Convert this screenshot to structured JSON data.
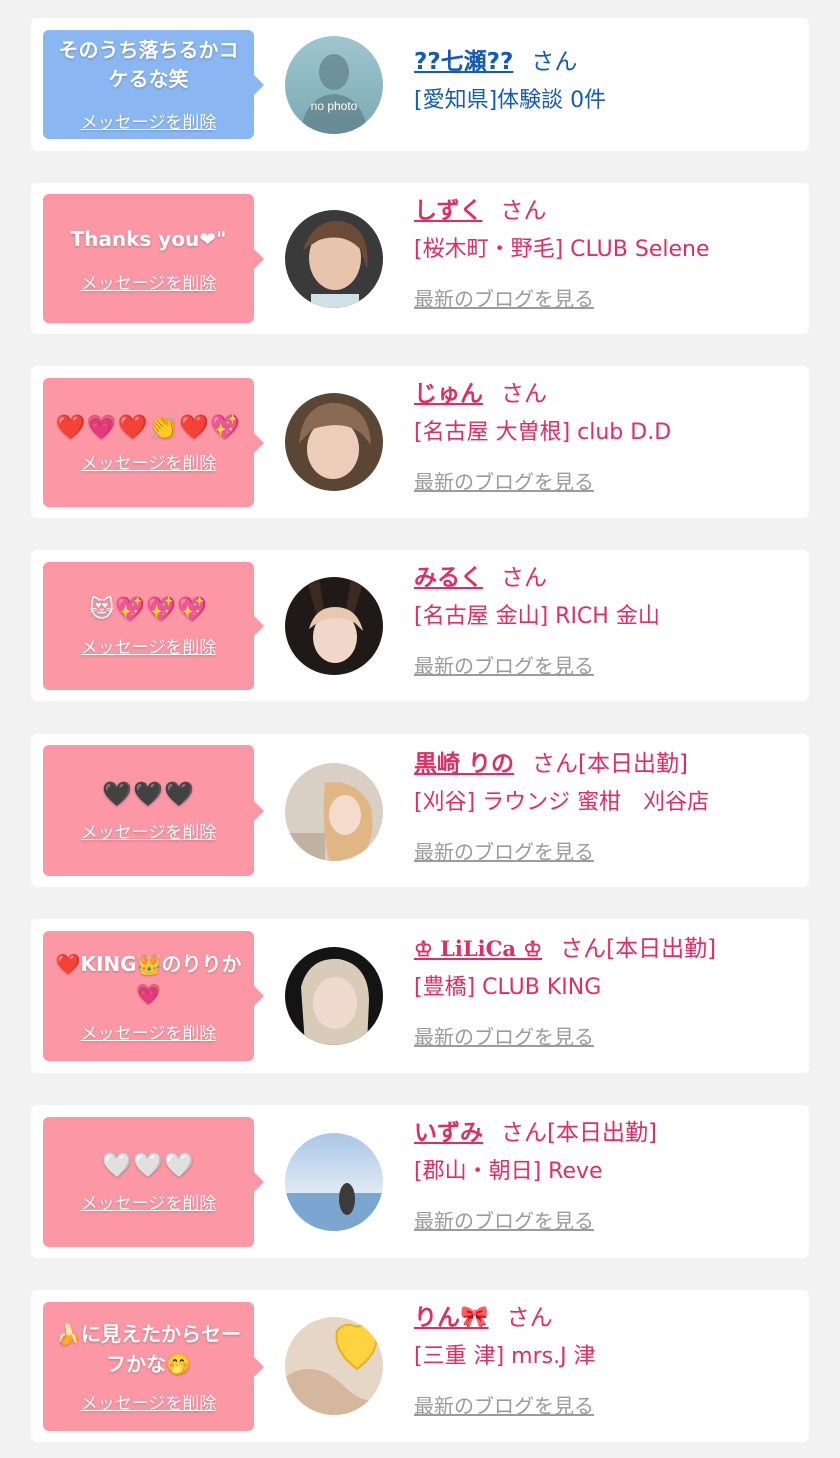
{
  "items": [
    {
      "message": "そのうち落ちるかコケるな笑",
      "delete_label": "メッセージを削除",
      "name": "??七瀬??",
      "suffix": "さん",
      "shop": "[愛知県]体験談 0件",
      "blog": ""
    },
    {
      "message": "Thanks you❤\"",
      "delete_label": "メッセージを削除",
      "name": "しずく",
      "suffix": "さん",
      "shop": "[桜木町・野毛] CLUB Selene",
      "blog": "最新のブログを見る"
    },
    {
      "message": "❤️💗❤️👏❤️💖",
      "delete_label": "メッセージを削除",
      "name": "じゅん",
      "suffix": "さん",
      "shop": "[名古屋 大曽根] club D.D",
      "blog": "最新のブログを見る"
    },
    {
      "message": "😻💖💖💖",
      "delete_label": "メッセージを削除",
      "name": "みるく",
      "suffix": "さん",
      "shop": "[名古屋 金山] RICH 金山",
      "blog": "最新のブログを見る"
    },
    {
      "message": "🖤🖤🖤",
      "delete_label": "メッセージを削除",
      "name": "黒崎 りの",
      "suffix": "さん[本日出勤]",
      "shop": "[刈谷] ラウンジ 蜜柑　刈谷店",
      "blog": "最新のブログを見る"
    },
    {
      "message": "❤️KING👑のりりか💗",
      "delete_label": "メッセージを削除",
      "name": "♔ LiLiCa ♔",
      "suffix": "さん[本日出勤]",
      "shop": "[豊橋] CLUB KING",
      "blog": "最新のブログを見る"
    },
    {
      "message": "🤍🤍🤍",
      "delete_label": "メッセージを削除",
      "name": "いずみ",
      "suffix": "さん[本日出勤]",
      "shop": "[郡山・朝日] Reve",
      "blog": "最新のブログを見る"
    },
    {
      "message": "🍌に見えたからセーフかな🤭",
      "delete_label": "メッセージを削除",
      "name": "りん🎀",
      "suffix": "さん",
      "shop": "[三重 津] mrs.J 津",
      "blog": "最新のブログを見る"
    }
  ],
  "avatar_placeholder": "no photo",
  "colors": {
    "pink_bubble": "#fc97a5",
    "blue_bubble": "#8ab7f2",
    "name_pink": "#e02d62",
    "name_blue": "#155bb5",
    "blog_gray": "#9b9b9b"
  }
}
